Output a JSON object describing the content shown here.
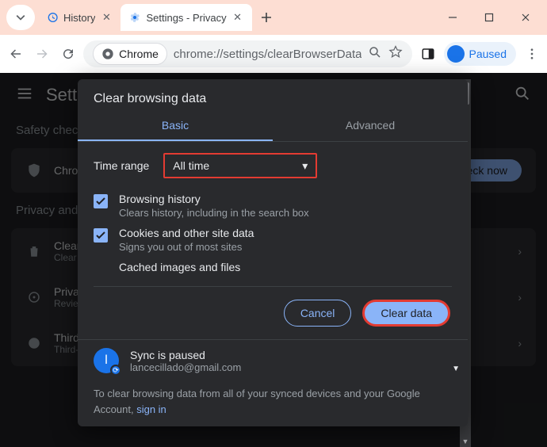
{
  "tabs": [
    {
      "label": "History",
      "active": false
    },
    {
      "label": "Settings - Privacy",
      "active": true
    }
  ],
  "omnibox": {
    "chip_label": "Chrome",
    "url": "chrome://settings/clearBrowserData"
  },
  "profile": {
    "label": "Paused"
  },
  "settings_page": {
    "title": "Settings",
    "section_safety": "Safety check",
    "safety_row": {
      "title": "Chrome can help keep you safe",
      "cta": "Check now"
    },
    "section_privacy": "Privacy and security",
    "rows": [
      {
        "title": "Clear browsing data",
        "sub": "Clear history, cookies, cache, and more"
      },
      {
        "title": "Privacy Guide",
        "sub": "Review key privacy and security controls"
      },
      {
        "title": "Third-party cookies",
        "sub": "Third-party cookies are blocked in Incognito"
      }
    ]
  },
  "modal": {
    "title": "Clear browsing data",
    "tab_basic": "Basic",
    "tab_advanced": "Advanced",
    "time_label": "Time range",
    "time_value": "All time",
    "items": [
      {
        "title": "Browsing history",
        "sub": "Clears history, including in the search box",
        "checked": true
      },
      {
        "title": "Cookies and other site data",
        "sub": "Signs you out of most sites",
        "checked": true
      },
      {
        "title": "Cached images and files",
        "sub": "",
        "checked": true
      }
    ],
    "btn_cancel": "Cancel",
    "btn_clear": "Clear data",
    "sync_title": "Sync is paused",
    "sync_email": "lancecillado@gmail.com",
    "sync_initial": "l",
    "footer_text": "To clear browsing data from all of your synced devices and your Google Account, ",
    "footer_link": "sign in"
  }
}
